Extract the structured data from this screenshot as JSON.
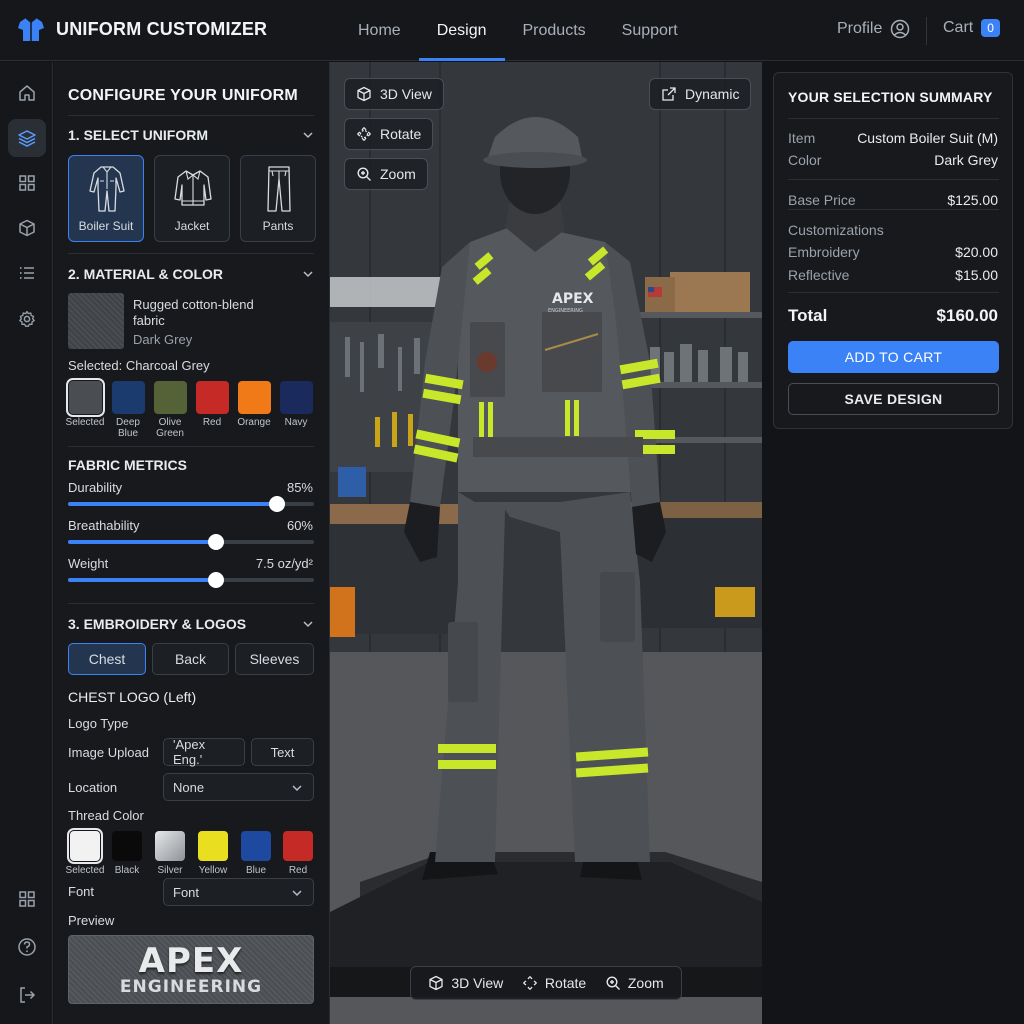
{
  "app": {
    "title": "UNIFORM CUSTOMIZER",
    "logo_icon": "tshirt-icon"
  },
  "nav": {
    "links": [
      "Home",
      "Design",
      "Products",
      "Support"
    ],
    "active": "Design",
    "profile_label": "Profile",
    "cart_label": "Cart",
    "cart_count": "0"
  },
  "rail": {
    "icons": [
      "home-icon",
      "layers-icon",
      "grid-icon",
      "box-icon",
      "list-icon",
      "settings-icon",
      "apps-icon",
      "help-icon",
      "logout-icon"
    ],
    "active": "layers-icon"
  },
  "config": {
    "title": "CONFIGURE YOUR UNIFORM",
    "uniform_section": "1. SELECT UNIFORM",
    "uniforms": [
      {
        "label": "Boiler Suit",
        "selected": true
      },
      {
        "label": "Jacket",
        "selected": false
      },
      {
        "label": "Pants",
        "selected": false
      }
    ],
    "material_section": "2. MATERIAL & COLOR",
    "fabric_name": "Rugged cotton-blend fabric",
    "fabric_name_line1": "Rugged cotton-blend",
    "fabric_name_line2": "fabric",
    "fabric_color": "Dark Grey",
    "selected_color_text": "Selected: Charcoal Grey",
    "colors": [
      {
        "label": "Selected",
        "hex": "#4a4d51"
      },
      {
        "label": "Deep Blue",
        "line1": "Deep",
        "line2": "Blue",
        "hex": "#1b3a6e"
      },
      {
        "label": "Olive Green",
        "line1": "Olive",
        "line2": "Green",
        "hex": "#556238"
      },
      {
        "label": "Red",
        "hex": "#c62a27"
      },
      {
        "label": "Orange",
        "hex": "#f07a17"
      },
      {
        "label": "Navy",
        "hex": "#1a2a5c"
      }
    ],
    "metrics_title": "FABRIC METRICS",
    "metrics": [
      {
        "label": "Durability",
        "value_text": "85%",
        "value": 0.85
      },
      {
        "label": "Breathability",
        "value_text": "60%",
        "value": 0.6
      },
      {
        "label": "Weight",
        "value_text": "7.5 oz/yd²",
        "value": 0.6
      }
    ],
    "embroidery_section": "3. EMBROIDERY & LOGOS",
    "placements": [
      {
        "label": "Chest",
        "selected": true
      },
      {
        "label": "Back",
        "selected": false
      },
      {
        "label": "Sleeves",
        "selected": false
      }
    ],
    "chest_logo_title": "CHEST LOGO (Left)",
    "logo_type_label": "Logo Type",
    "image_upload_label": "Image Upload",
    "text_value": "'Apex Eng.'",
    "text_button": "Text",
    "location_label": "Location",
    "location_value": "None",
    "thread_color_label": "Thread Color",
    "thread_colors": [
      {
        "label": "Selected",
        "hex": "#f2f2f2"
      },
      {
        "label": "Black",
        "hex": "#0a0a0a"
      },
      {
        "label": "Silver",
        "hex": "#bfc2c6"
      },
      {
        "label": "Yellow",
        "hex": "#e9de1f"
      },
      {
        "label": "Blue",
        "hex": "#1d4aa0"
      },
      {
        "label": "Red",
        "hex": "#c62a27"
      }
    ],
    "font_label": "Font",
    "font_value": "Font",
    "preview_label": "Preview",
    "preview_line1": "APEX",
    "preview_line2": "ENGINEERING"
  },
  "viewport": {
    "buttons": [
      "3D View",
      "Rotate",
      "Zoom"
    ],
    "dynamic_button": "Dynamic",
    "bottom_bar": [
      "3D View",
      "Rotate",
      "Zoom"
    ],
    "suit_brand_line1": "APEX",
    "suit_brand_line2": "ENGINEERING",
    "suit_color": "#4d5054",
    "reflective_color": "#c8e62a"
  },
  "summary": {
    "title": "YOUR SELECTION SUMMARY",
    "item_label": "Item",
    "item_value": "Custom Boiler Suit (M)",
    "color_label": "Color",
    "color_value": "Dark Grey",
    "base_label": "Base Price",
    "base_value": "$125.00",
    "custom_label": "Customizations",
    "embroidery_label": "Embroidery",
    "embroidery_value": "$20.00",
    "reflective_label": "Reflective",
    "reflective_value": "$15.00",
    "total_label": "Total",
    "total_value": "$160.00",
    "add_button": "ADD TO CART",
    "save_button": "SAVE DESIGN"
  }
}
